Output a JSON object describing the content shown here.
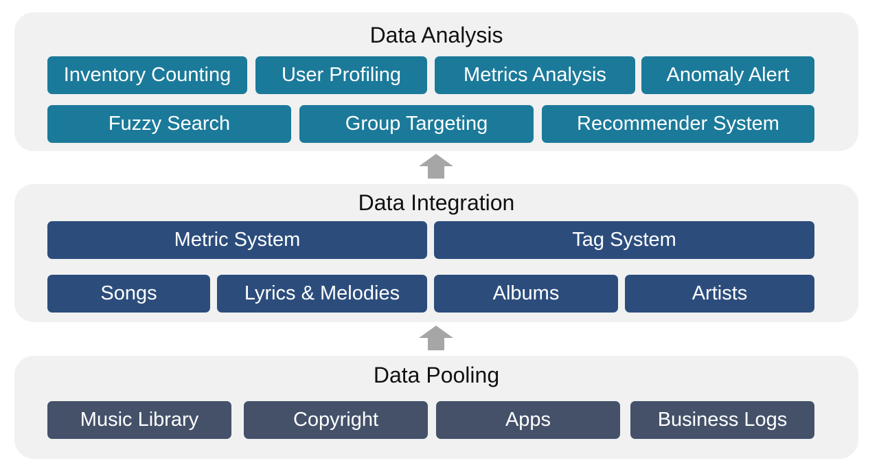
{
  "layers": {
    "analysis": {
      "title": "Data Analysis",
      "row1": [
        "Inventory Counting",
        "User Profiling",
        "Metrics Analysis",
        "Anomaly Alert"
      ],
      "row2": [
        "Fuzzy Search",
        "Group Targeting",
        "Recommender System"
      ]
    },
    "integration": {
      "title": "Data Integration",
      "row1": [
        "Metric System",
        "Tag System"
      ],
      "row2": [
        "Songs",
        "Lyrics & Melodies",
        "Albums",
        "Artists"
      ]
    },
    "pooling": {
      "title": "Data Pooling",
      "row1": [
        "Music Library",
        "Copyright",
        "Apps",
        "Business Logs"
      ]
    }
  },
  "colors": {
    "analysis_box": "#1b7a9a",
    "integration_box": "#2c4d7c",
    "pooling_box": "#445169",
    "panel_bg": "#f1f1f1",
    "arrow": "#a6a6a6"
  }
}
